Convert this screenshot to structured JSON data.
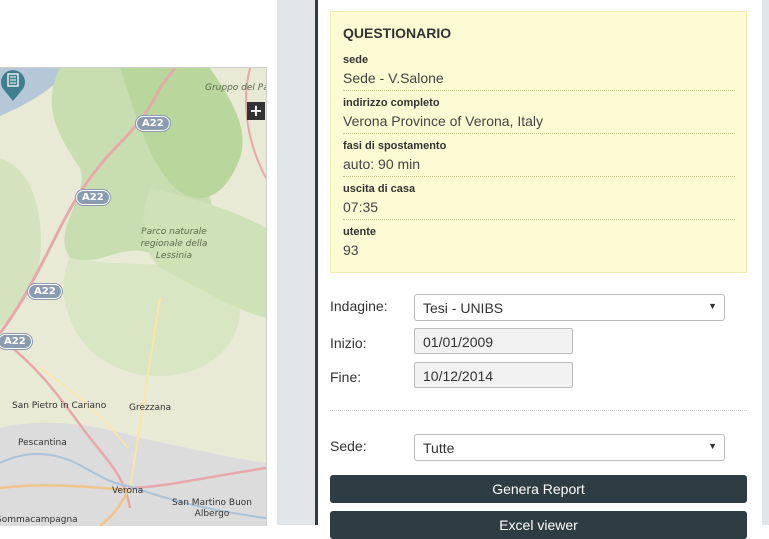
{
  "map": {
    "zoom_in_symbol": "+",
    "labels": {
      "gruppo_pasubio": "Gruppo del Pasubio",
      "parco_lessinia": "Parco naturale regionale della Lessinia",
      "san_pietro": "San Pietro in Cariano",
      "grezzana": "Grezzana",
      "pescantina": "Pescantina",
      "verona": "Verona",
      "san_martino": "San Martino Buon Albergo",
      "sommacampagna": "Sommacampagna"
    },
    "road_shields": [
      "A22",
      "A22",
      "A22",
      "A22"
    ],
    "marker_icon": "document-marker-icon"
  },
  "questionario": {
    "title": "QUESTIONARIO",
    "fields": [
      {
        "label": "sede",
        "value": "Sede - V.Salone"
      },
      {
        "label": "indirizzo completo",
        "value": "Verona Province of Verona, Italy"
      },
      {
        "label": "fasi di spostamento",
        "value": "auto: 90 min"
      },
      {
        "label": "uscita di casa",
        "value": "07:35"
      },
      {
        "label": "utente",
        "value": "93"
      }
    ]
  },
  "form": {
    "indagine_label": "Indagine:",
    "indagine_value": "Tesi - UNIBS",
    "inizio_label": "Inizio:",
    "inizio_value": "01/01/2009",
    "fine_label": "Fine:",
    "fine_value": "10/12/2014",
    "sede_label": "Sede:",
    "sede_value": "Tutte",
    "dropdown_arrow": "▼"
  },
  "buttons": {
    "genera_report": "Genera Report",
    "excel_viewer": "Excel viewer"
  },
  "colors": {
    "accent_dark": "#2e3d44",
    "card_bg": "#fdfbd3",
    "map_green": "#c9deb0"
  }
}
